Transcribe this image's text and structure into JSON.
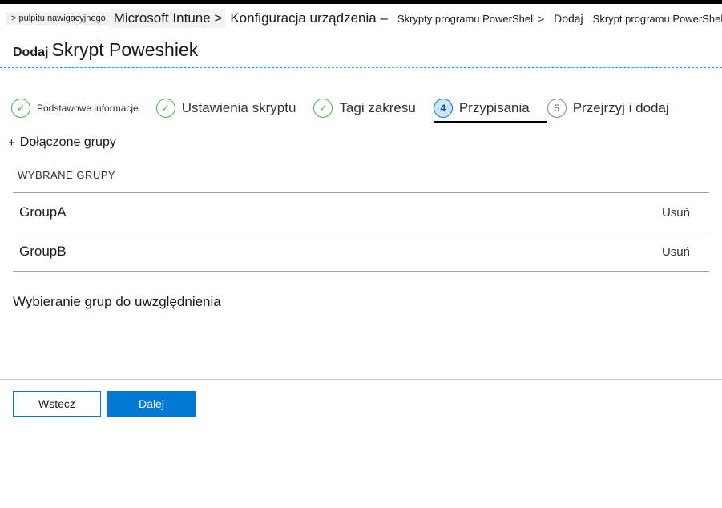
{
  "breadcrumb": {
    "dashboard": "> pulpitu nawigacyjnego",
    "intune": "Microsoft Intune >",
    "config": "Konfiguracja urządzenia –",
    "scripts": "Skrypty programu PowerShell >",
    "add": "Dodaj",
    "final": "Skrypt programu PowerShell"
  },
  "header": {
    "add_label": "Dodaj",
    "script_name": "Skrypt Poweshiek"
  },
  "wizard": {
    "steps": [
      {
        "label": "Podstawowe informacje",
        "state": "done"
      },
      {
        "label": "Ustawienia skryptu",
        "state": "done"
      },
      {
        "label": "Tagi zakresu",
        "state": "done"
      },
      {
        "num": "4",
        "label": "Przypisania",
        "state": "active"
      },
      {
        "num": "5",
        "label": "Przejrzyj i dodaj",
        "state": "upcoming"
      }
    ]
  },
  "assignments": {
    "included_groups_toggle": "Dołączone grupy",
    "selected_groups_header": "WYBRANE GRUPY",
    "groups": [
      {
        "name": "GroupA",
        "remove": "Usuń"
      },
      {
        "name": "GroupB",
        "remove": "Usuń"
      }
    ],
    "select_groups_label": "Wybieranie grup do uwzględnienia"
  },
  "footer": {
    "back": "Wstecz",
    "next": "Dalej"
  }
}
